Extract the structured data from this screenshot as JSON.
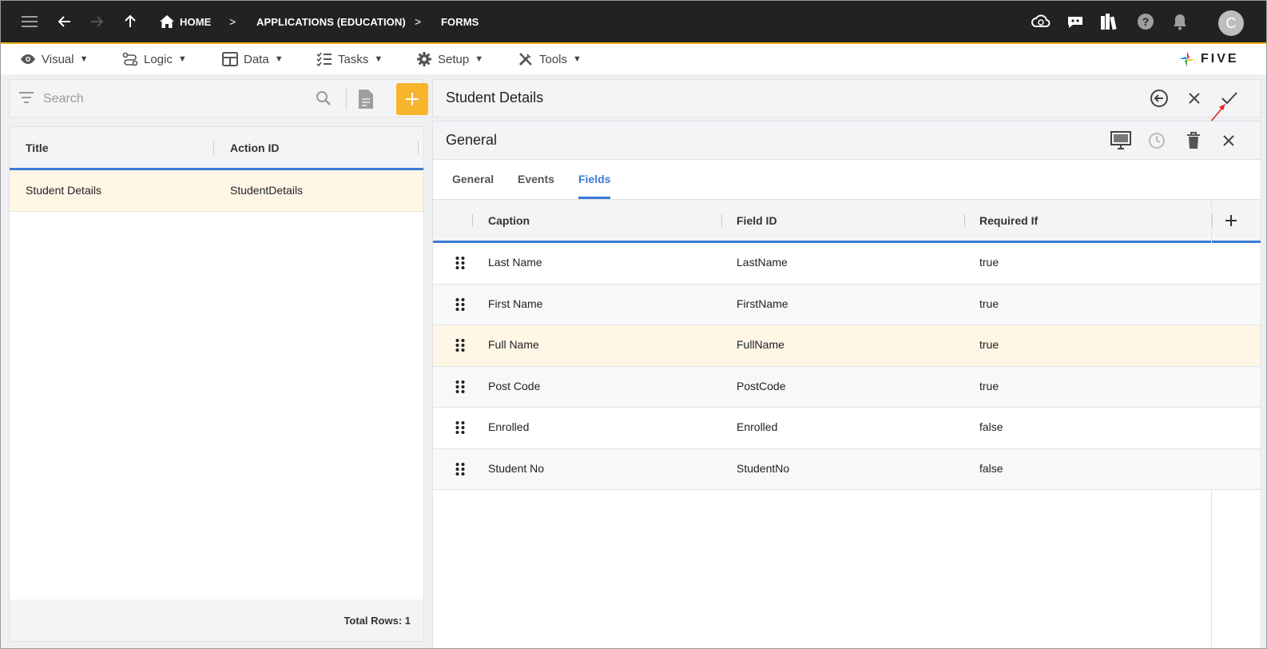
{
  "topbar": {
    "breadcrumbs": [
      "HOME",
      "APPLICATIONS (EDUCATION)",
      "FORMS"
    ],
    "avatar_initial": "C",
    "icons": [
      "menu-icon",
      "back-arrow-icon",
      "forward-arrow-icon",
      "up-arrow-icon",
      "home-icon",
      "cloud-sync-icon",
      "chat-bot-icon",
      "library-icon",
      "help-icon",
      "notifications-icon"
    ]
  },
  "menubar": {
    "items": [
      {
        "label": "Visual",
        "icon": "eye-icon"
      },
      {
        "label": "Logic",
        "icon": "flow-icon"
      },
      {
        "label": "Data",
        "icon": "table-icon"
      },
      {
        "label": "Tasks",
        "icon": "checklist-icon"
      },
      {
        "label": "Setup",
        "icon": "gear-icon"
      },
      {
        "label": "Tools",
        "icon": "tools-icon"
      }
    ],
    "caret": "▼",
    "logo_text": "FIVE"
  },
  "left": {
    "search_placeholder": "Search",
    "columns": [
      "Title",
      "Action ID"
    ],
    "rows": [
      {
        "title": "Student Details",
        "action_id": "StudentDetails"
      }
    ],
    "total_rows": "Total Rows: 1"
  },
  "right": {
    "title": "Student Details",
    "section_title": "General",
    "tabs": [
      "General",
      "Events",
      "Fields"
    ],
    "active_tab": "Fields",
    "columns": [
      "Caption",
      "Field ID",
      "Required If"
    ],
    "rows": [
      {
        "caption": "Last Name",
        "field_id": "LastName",
        "required_if": "true"
      },
      {
        "caption": "First Name",
        "field_id": "FirstName",
        "required_if": "true"
      },
      {
        "caption": "Full Name",
        "field_id": "FullName",
        "required_if": "true"
      },
      {
        "caption": "Post Code",
        "field_id": "PostCode",
        "required_if": "true"
      },
      {
        "caption": "Enrolled",
        "field_id": "Enrolled",
        "required_if": "false"
      },
      {
        "caption": "Student No",
        "field_id": "StudentNo",
        "required_if": "false"
      }
    ]
  },
  "colors": {
    "accent": "#3a7bd5",
    "brand_yellow": "#f7b52c",
    "topbar": "#222222",
    "selected_row": "#fff6e6"
  }
}
